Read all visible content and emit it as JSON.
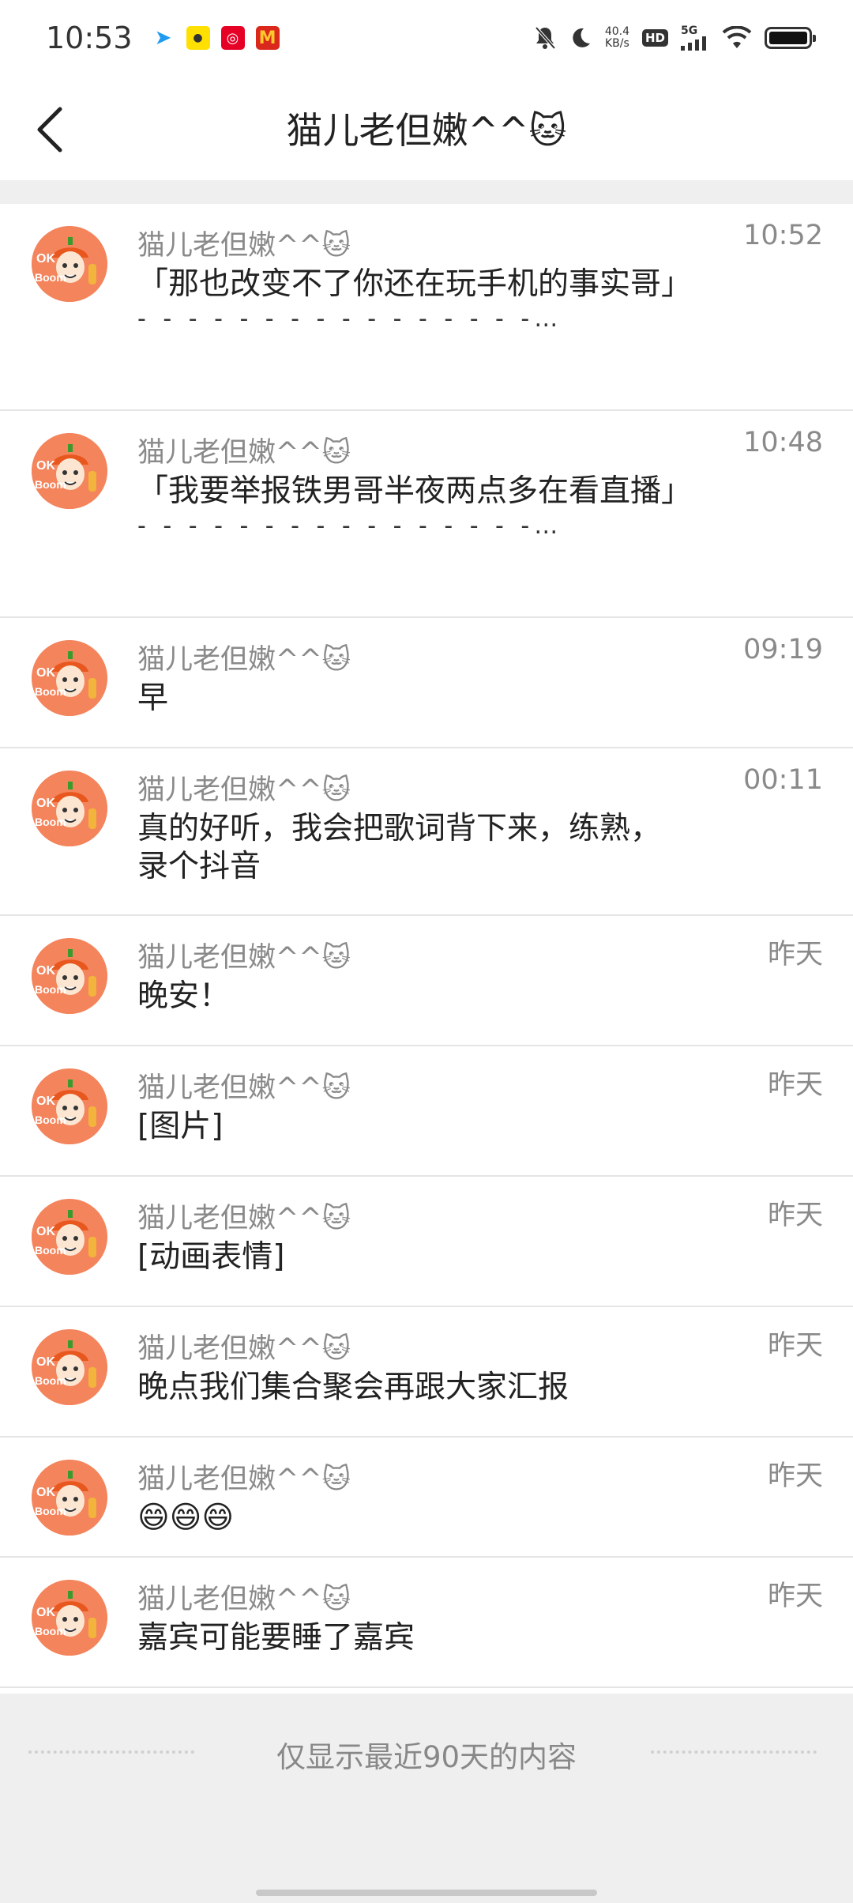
{
  "status_bar": {
    "time": "10:53",
    "net_speed_value": "40.4",
    "net_speed_unit": "KB/s",
    "hd": "HD",
    "signal": "5G"
  },
  "header": {
    "title": "猫儿老但嫩^^🐱",
    "back_icon": "chevron-left-icon"
  },
  "messages": [
    {
      "sender": "猫儿老但嫩^^🐱",
      "time": "10:52",
      "text": "「那也改变不了你还在玩手机的事实哥」",
      "quote_tail": "- - - - - - - - - - - - - - - -…"
    },
    {
      "sender": "猫儿老但嫩^^🐱",
      "time": "10:48",
      "text": "「我要举报铁男哥半夜两点多在看直播」",
      "quote_tail": "- - - - - - - - - - - - - - - -…"
    },
    {
      "sender": "猫儿老但嫩^^🐱",
      "time": "09:19",
      "text": "早"
    },
    {
      "sender": "猫儿老但嫩^^🐱",
      "time": "00:11",
      "text": "真的好听，我会把歌词背下来，练熟，录个抖音"
    },
    {
      "sender": "猫儿老但嫩^^🐱",
      "time": "昨天",
      "text": "晚安！"
    },
    {
      "sender": "猫儿老但嫩^^🐱",
      "time": "昨天",
      "text": "[图片]"
    },
    {
      "sender": "猫儿老但嫩^^🐱",
      "time": "昨天",
      "text": "[动画表情]"
    },
    {
      "sender": "猫儿老但嫩^^🐱",
      "time": "昨天",
      "text": "晚点我们集合聚会再跟大家汇报"
    },
    {
      "sender": "猫儿老但嫩^^🐱",
      "time": "昨天",
      "text": "😄😄😄"
    },
    {
      "sender": "猫儿老但嫩^^🐱",
      "time": "昨天",
      "text": "嘉宾可能要睡了嘉宾"
    }
  ],
  "footer": {
    "notice": "仅显示最近90天的内容"
  },
  "colors": {
    "avatar_bg": "#f4845c",
    "separator": "#efefef",
    "meta_text": "#8a8a8a"
  }
}
